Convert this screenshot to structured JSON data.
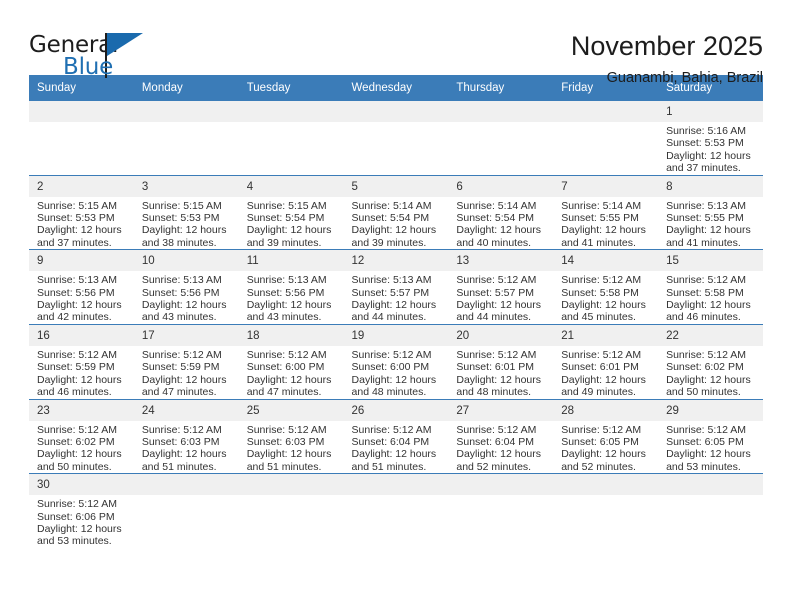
{
  "brand": {
    "name_part1": "General",
    "name_part2": "Blue",
    "logo_icon": "general-blue-flag-logo"
  },
  "header": {
    "title": "November 2025",
    "subtitle": "Guanambi, Bahia, Brazil"
  },
  "calendar": {
    "weekday_headers": [
      "Sunday",
      "Monday",
      "Tuesday",
      "Wednesday",
      "Thursday",
      "Friday",
      "Saturday"
    ],
    "accent_color": "#3b7cb8",
    "daynum_band_color": "#f0f0f0",
    "weeks": [
      [
        {
          "day": "",
          "empty": true,
          "lines": []
        },
        {
          "day": "",
          "empty": true,
          "lines": []
        },
        {
          "day": "",
          "empty": true,
          "lines": []
        },
        {
          "day": "",
          "empty": true,
          "lines": []
        },
        {
          "day": "",
          "empty": true,
          "lines": []
        },
        {
          "day": "",
          "empty": true,
          "lines": []
        },
        {
          "day": "1",
          "empty": false,
          "lines": [
            "Sunrise: 5:16 AM",
            "Sunset: 5:53 PM",
            "Daylight: 12 hours",
            "and 37 minutes."
          ]
        }
      ],
      [
        {
          "day": "2",
          "empty": false,
          "lines": [
            "Sunrise: 5:15 AM",
            "Sunset: 5:53 PM",
            "Daylight: 12 hours",
            "and 37 minutes."
          ]
        },
        {
          "day": "3",
          "empty": false,
          "lines": [
            "Sunrise: 5:15 AM",
            "Sunset: 5:53 PM",
            "Daylight: 12 hours",
            "and 38 minutes."
          ]
        },
        {
          "day": "4",
          "empty": false,
          "lines": [
            "Sunrise: 5:15 AM",
            "Sunset: 5:54 PM",
            "Daylight: 12 hours",
            "and 39 minutes."
          ]
        },
        {
          "day": "5",
          "empty": false,
          "lines": [
            "Sunrise: 5:14 AM",
            "Sunset: 5:54 PM",
            "Daylight: 12 hours",
            "and 39 minutes."
          ]
        },
        {
          "day": "6",
          "empty": false,
          "lines": [
            "Sunrise: 5:14 AM",
            "Sunset: 5:54 PM",
            "Daylight: 12 hours",
            "and 40 minutes."
          ]
        },
        {
          "day": "7",
          "empty": false,
          "lines": [
            "Sunrise: 5:14 AM",
            "Sunset: 5:55 PM",
            "Daylight: 12 hours",
            "and 41 minutes."
          ]
        },
        {
          "day": "8",
          "empty": false,
          "lines": [
            "Sunrise: 5:13 AM",
            "Sunset: 5:55 PM",
            "Daylight: 12 hours",
            "and 41 minutes."
          ]
        }
      ],
      [
        {
          "day": "9",
          "empty": false,
          "lines": [
            "Sunrise: 5:13 AM",
            "Sunset: 5:56 PM",
            "Daylight: 12 hours",
            "and 42 minutes."
          ]
        },
        {
          "day": "10",
          "empty": false,
          "lines": [
            "Sunrise: 5:13 AM",
            "Sunset: 5:56 PM",
            "Daylight: 12 hours",
            "and 43 minutes."
          ]
        },
        {
          "day": "11",
          "empty": false,
          "lines": [
            "Sunrise: 5:13 AM",
            "Sunset: 5:56 PM",
            "Daylight: 12 hours",
            "and 43 minutes."
          ]
        },
        {
          "day": "12",
          "empty": false,
          "lines": [
            "Sunrise: 5:13 AM",
            "Sunset: 5:57 PM",
            "Daylight: 12 hours",
            "and 44 minutes."
          ]
        },
        {
          "day": "13",
          "empty": false,
          "lines": [
            "Sunrise: 5:12 AM",
            "Sunset: 5:57 PM",
            "Daylight: 12 hours",
            "and 44 minutes."
          ]
        },
        {
          "day": "14",
          "empty": false,
          "lines": [
            "Sunrise: 5:12 AM",
            "Sunset: 5:58 PM",
            "Daylight: 12 hours",
            "and 45 minutes."
          ]
        },
        {
          "day": "15",
          "empty": false,
          "lines": [
            "Sunrise: 5:12 AM",
            "Sunset: 5:58 PM",
            "Daylight: 12 hours",
            "and 46 minutes."
          ]
        }
      ],
      [
        {
          "day": "16",
          "empty": false,
          "lines": [
            "Sunrise: 5:12 AM",
            "Sunset: 5:59 PM",
            "Daylight: 12 hours",
            "and 46 minutes."
          ]
        },
        {
          "day": "17",
          "empty": false,
          "lines": [
            "Sunrise: 5:12 AM",
            "Sunset: 5:59 PM",
            "Daylight: 12 hours",
            "and 47 minutes."
          ]
        },
        {
          "day": "18",
          "empty": false,
          "lines": [
            "Sunrise: 5:12 AM",
            "Sunset: 6:00 PM",
            "Daylight: 12 hours",
            "and 47 minutes."
          ]
        },
        {
          "day": "19",
          "empty": false,
          "lines": [
            "Sunrise: 5:12 AM",
            "Sunset: 6:00 PM",
            "Daylight: 12 hours",
            "and 48 minutes."
          ]
        },
        {
          "day": "20",
          "empty": false,
          "lines": [
            "Sunrise: 5:12 AM",
            "Sunset: 6:01 PM",
            "Daylight: 12 hours",
            "and 48 minutes."
          ]
        },
        {
          "day": "21",
          "empty": false,
          "lines": [
            "Sunrise: 5:12 AM",
            "Sunset: 6:01 PM",
            "Daylight: 12 hours",
            "and 49 minutes."
          ]
        },
        {
          "day": "22",
          "empty": false,
          "lines": [
            "Sunrise: 5:12 AM",
            "Sunset: 6:02 PM",
            "Daylight: 12 hours",
            "and 50 minutes."
          ]
        }
      ],
      [
        {
          "day": "23",
          "empty": false,
          "lines": [
            "Sunrise: 5:12 AM",
            "Sunset: 6:02 PM",
            "Daylight: 12 hours",
            "and 50 minutes."
          ]
        },
        {
          "day": "24",
          "empty": false,
          "lines": [
            "Sunrise: 5:12 AM",
            "Sunset: 6:03 PM",
            "Daylight: 12 hours",
            "and 51 minutes."
          ]
        },
        {
          "day": "25",
          "empty": false,
          "lines": [
            "Sunrise: 5:12 AM",
            "Sunset: 6:03 PM",
            "Daylight: 12 hours",
            "and 51 minutes."
          ]
        },
        {
          "day": "26",
          "empty": false,
          "lines": [
            "Sunrise: 5:12 AM",
            "Sunset: 6:04 PM",
            "Daylight: 12 hours",
            "and 51 minutes."
          ]
        },
        {
          "day": "27",
          "empty": false,
          "lines": [
            "Sunrise: 5:12 AM",
            "Sunset: 6:04 PM",
            "Daylight: 12 hours",
            "and 52 minutes."
          ]
        },
        {
          "day": "28",
          "empty": false,
          "lines": [
            "Sunrise: 5:12 AM",
            "Sunset: 6:05 PM",
            "Daylight: 12 hours",
            "and 52 minutes."
          ]
        },
        {
          "day": "29",
          "empty": false,
          "lines": [
            "Sunrise: 5:12 AM",
            "Sunset: 6:05 PM",
            "Daylight: 12 hours",
            "and 53 minutes."
          ]
        }
      ],
      [
        {
          "day": "30",
          "empty": false,
          "lines": [
            "Sunrise: 5:12 AM",
            "Sunset: 6:06 PM",
            "Daylight: 12 hours",
            "and 53 minutes."
          ]
        },
        {
          "day": "",
          "empty": true,
          "lines": []
        },
        {
          "day": "",
          "empty": true,
          "lines": []
        },
        {
          "day": "",
          "empty": true,
          "lines": []
        },
        {
          "day": "",
          "empty": true,
          "lines": []
        },
        {
          "day": "",
          "empty": true,
          "lines": []
        },
        {
          "day": "",
          "empty": true,
          "lines": []
        }
      ]
    ]
  }
}
